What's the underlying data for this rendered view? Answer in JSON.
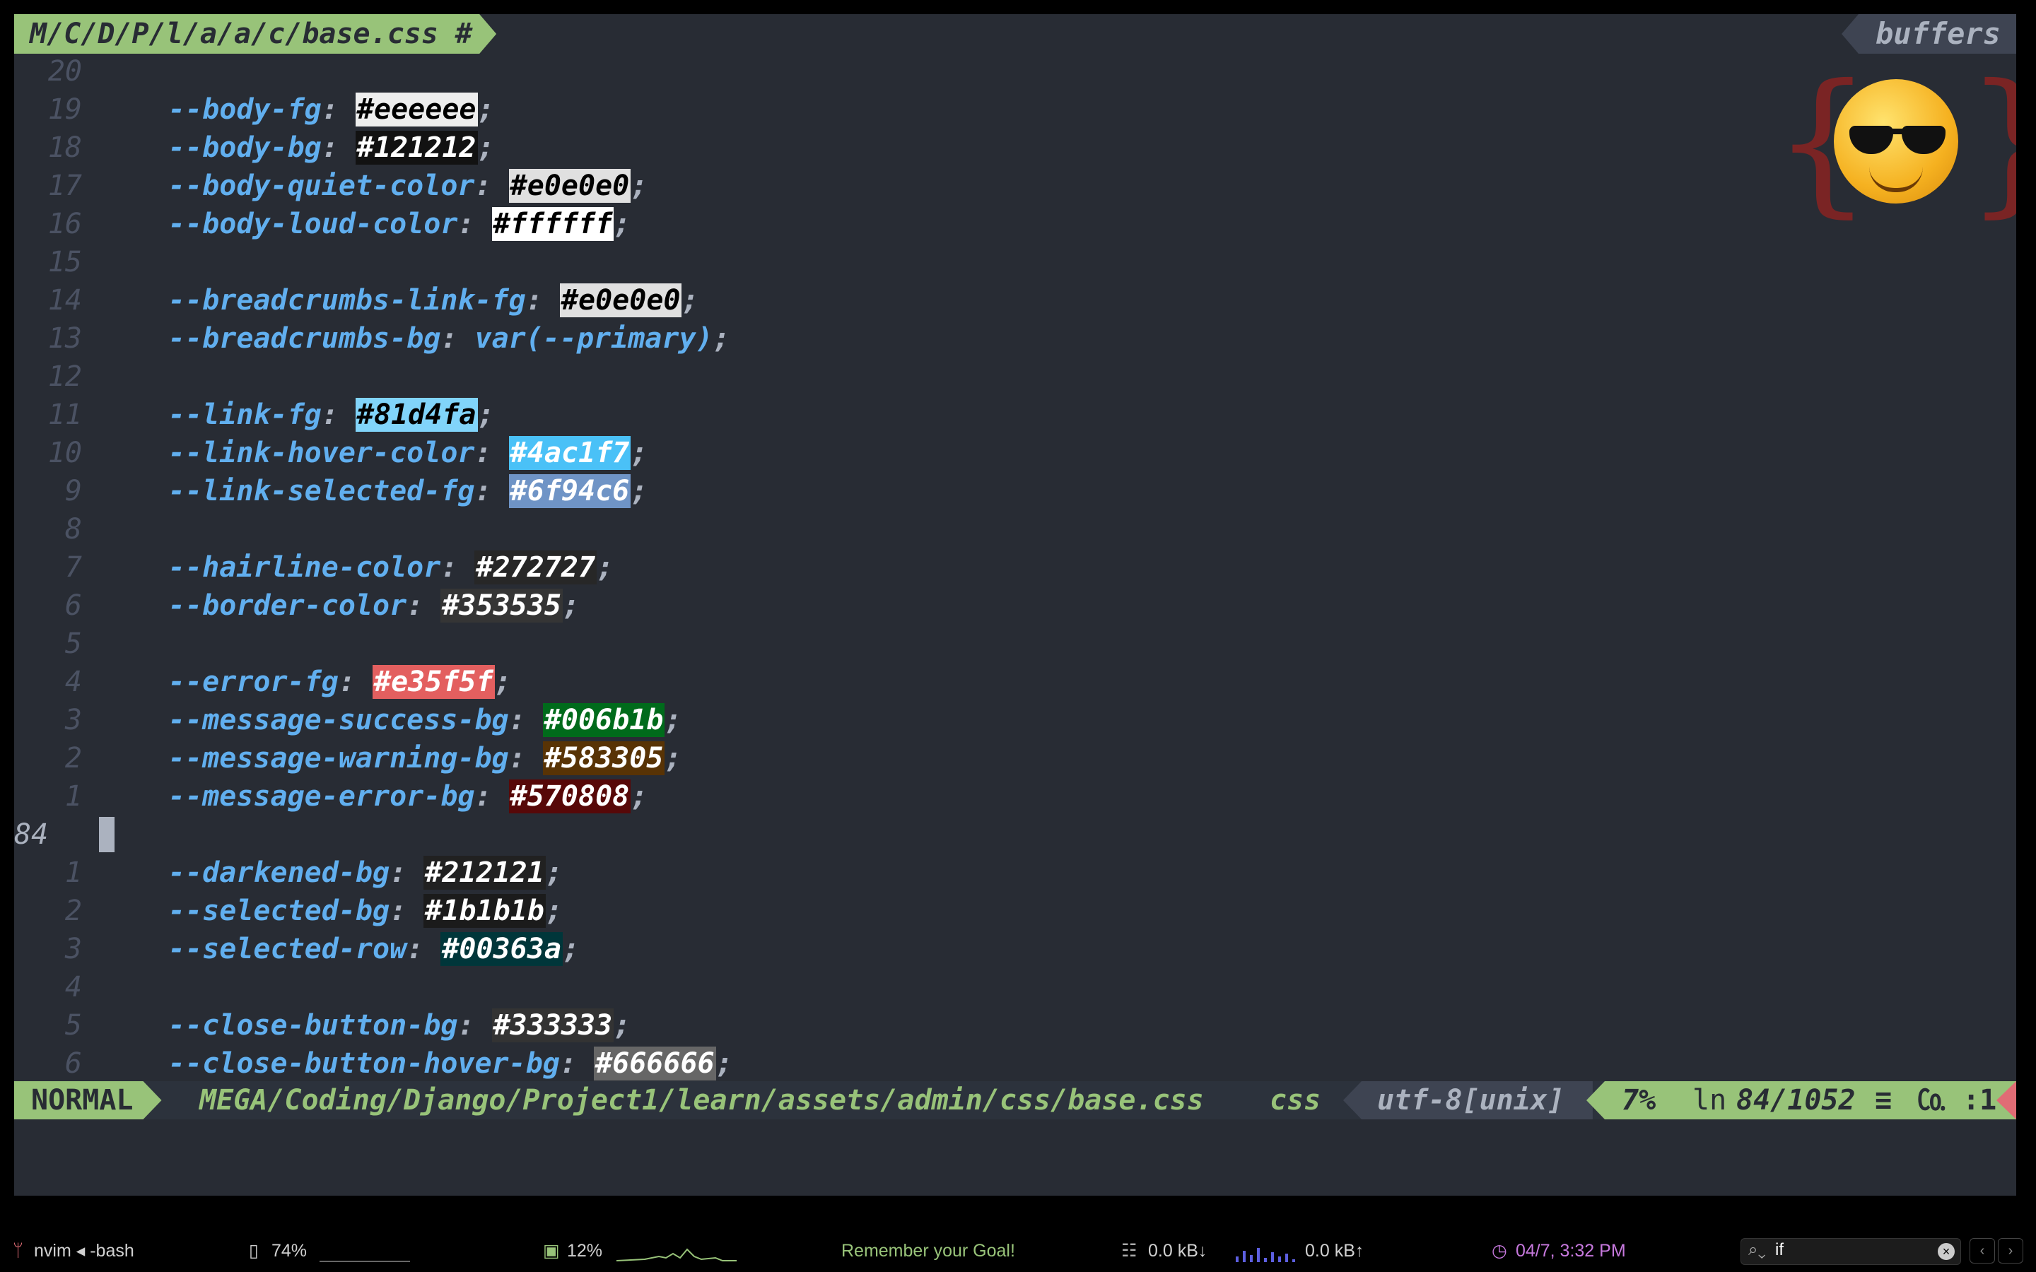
{
  "tabline": {
    "file": "M/C/D/P/l/a/a/c/base.css #",
    "buffers": "buffers"
  },
  "lines": [
    {
      "num": "20",
      "prop": "",
      "value": "",
      "bg": "",
      "fg": ""
    },
    {
      "num": "19",
      "prop": "--body-fg",
      "value": "#eeeeee",
      "bg": "#eeeeee",
      "fg": "#000000"
    },
    {
      "num": "18",
      "prop": "--body-bg",
      "value": "#121212",
      "bg": "#121212",
      "fg": "#ffffff"
    },
    {
      "num": "17",
      "prop": "--body-quiet-color",
      "value": "#e0e0e0",
      "bg": "#e0e0e0",
      "fg": "#000000"
    },
    {
      "num": "16",
      "prop": "--body-loud-color",
      "value": "#ffffff",
      "bg": "#ffffff",
      "fg": "#000000"
    },
    {
      "num": "15",
      "prop": "",
      "value": "",
      "bg": "",
      "fg": ""
    },
    {
      "num": "14",
      "prop": "--breadcrumbs-link-fg",
      "value": "#e0e0e0",
      "bg": "#e0e0e0",
      "fg": "#000000"
    },
    {
      "num": "13",
      "prop": "--breadcrumbs-bg",
      "value": "var(--primary)",
      "bg": "",
      "fg": "#61afef"
    },
    {
      "num": "12",
      "prop": "",
      "value": "",
      "bg": "",
      "fg": ""
    },
    {
      "num": "11",
      "prop": "--link-fg",
      "value": "#81d4fa",
      "bg": "#81d4fa",
      "fg": "#000000"
    },
    {
      "num": "10",
      "prop": "--link-hover-color",
      "value": "#4ac1f7",
      "bg": "#4ac1f7",
      "fg": "#ffffff"
    },
    {
      "num": "9",
      "prop": "--link-selected-fg",
      "value": "#6f94c6",
      "bg": "#6f94c6",
      "fg": "#ffffff"
    },
    {
      "num": "8",
      "prop": "",
      "value": "",
      "bg": "",
      "fg": ""
    },
    {
      "num": "7",
      "prop": "--hairline-color",
      "value": "#272727",
      "bg": "#272727",
      "fg": "#ffffff"
    },
    {
      "num": "6",
      "prop": "--border-color",
      "value": "#353535",
      "bg": "#353535",
      "fg": "#ffffff"
    },
    {
      "num": "5",
      "prop": "",
      "value": "",
      "bg": "",
      "fg": ""
    },
    {
      "num": "4",
      "prop": "--error-fg",
      "value": "#e35f5f",
      "bg": "#e35f5f",
      "fg": "#ffffff"
    },
    {
      "num": "3",
      "prop": "--message-success-bg",
      "value": "#006b1b",
      "bg": "#006b1b",
      "fg": "#ffffff"
    },
    {
      "num": "2",
      "prop": "--message-warning-bg",
      "value": "#583305",
      "bg": "#583305",
      "fg": "#ffffff"
    },
    {
      "num": "1",
      "prop": "--message-error-bg",
      "value": "#570808",
      "bg": "#570808",
      "fg": "#ffffff"
    },
    {
      "num": "84",
      "prop": "",
      "value": "",
      "bg": "",
      "fg": "",
      "current": true
    },
    {
      "num": "1",
      "prop": "--darkened-bg",
      "value": "#212121",
      "bg": "#212121",
      "fg": "#ffffff"
    },
    {
      "num": "2",
      "prop": "--selected-bg",
      "value": "#1b1b1b",
      "bg": "#1b1b1b",
      "fg": "#ffffff"
    },
    {
      "num": "3",
      "prop": "--selected-row",
      "value": "#00363a",
      "bg": "#00363a",
      "fg": "#ffffff"
    },
    {
      "num": "4",
      "prop": "",
      "value": "",
      "bg": "",
      "fg": ""
    },
    {
      "num": "5",
      "prop": "--close-button-bg",
      "value": "#333333",
      "bg": "#333333",
      "fg": "#ffffff"
    },
    {
      "num": "6",
      "prop": "--close-button-hover-bg",
      "value": "#666666",
      "bg": "#666666",
      "fg": "#ffffff"
    }
  ],
  "statusline": {
    "mode": "NORMAL",
    "path": "MEGA/Coding/Django/Project1/learn/assets/admin/css/base.css",
    "filetype": "css",
    "encoding": "utf-8[unix]",
    "percent": "7%",
    "ln_icon": "ln",
    "position": "84/1052",
    "col_icon": "≡",
    "col": "㏇ :1"
  },
  "menubar": {
    "app": "nvim ◂ -bash",
    "battery": "74%",
    "cpu": "12%",
    "goal": "Remember your Goal!",
    "net_down": "0.0 kB↓",
    "net_up": "0.0 kB↑",
    "datetime": "04/7, 3:32 PM",
    "search_value": "if"
  },
  "colors": {
    "bg": "#282c34",
    "accent_green": "#98c379",
    "blue": "#61afef",
    "gutter": "#4b5263"
  }
}
